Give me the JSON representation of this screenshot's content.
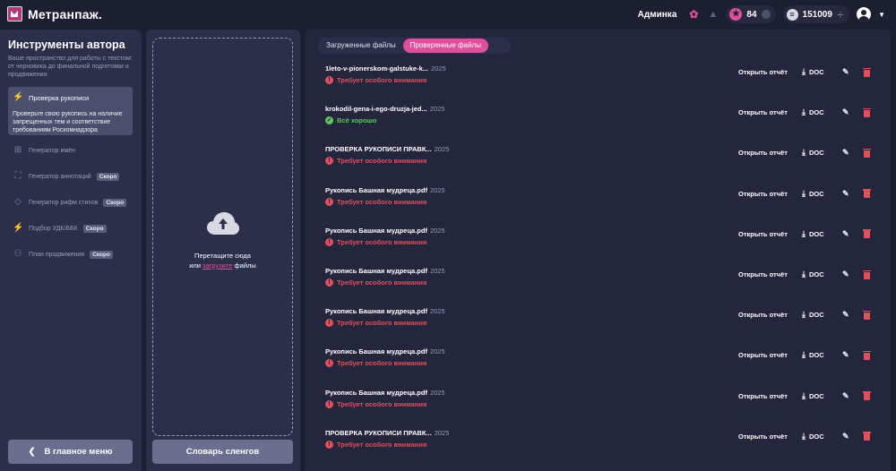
{
  "header": {
    "logo_text": "Метранпаж.",
    "user_name": "Админка",
    "stars": "84",
    "coins": "151009"
  },
  "sidebar": {
    "title": "Инструменты автора",
    "description": "Ваше пространство для работы с текстом: от черновика до финальной подготовки и продвижения.",
    "active": {
      "label": "Проверка рукописи",
      "description": "Проверьте свою рукопись на наличие запрещенных тем и соответствие требованиям Роскомнадзора"
    },
    "items": [
      {
        "label": "Генератор имён",
        "badge": ""
      },
      {
        "label": "Генератор аннотаций",
        "badge": "Скоро"
      },
      {
        "label": "Генератор рифм стихов",
        "badge": "Скоро"
      },
      {
        "label": "Подбор УДК/ББК",
        "badge": "Скоро"
      },
      {
        "label": "План продвижения",
        "badge": "Скоро"
      }
    ],
    "back_label": "В главное меню"
  },
  "upload": {
    "line1": "Перетащите сюда",
    "line2_pre": "или",
    "link": "загрузите",
    "line2_post": "файлы",
    "slang_button": "Словарь сленгов"
  },
  "tabs": {
    "uploaded": "Загруженные файлы",
    "checked": "Проверенные файлы"
  },
  "actions": {
    "open_report": "Открыть отчёт",
    "doc": "DOC"
  },
  "files": [
    {
      "name": "1leto-v-pionerskom-galstuke-k...",
      "year": "2025",
      "status": "Требует особого внимания",
      "ok": false
    },
    {
      "name": "krokodil-gena-i-ego-druzja-jed...",
      "year": "2025",
      "status": "Всё хорошо",
      "ok": true
    },
    {
      "name": "ПРОВЕРКА РУКОПИСИ ПРАВК...",
      "year": "2025",
      "status": "Требует особого внимания",
      "ok": false
    },
    {
      "name": "Рукопись Башная мудреца.pdf",
      "year": "2025",
      "status": "Требует особого внимания",
      "ok": false
    },
    {
      "name": "Рукопись Башная мудреца.pdf",
      "year": "2025",
      "status": "Требует особого внимания",
      "ok": false
    },
    {
      "name": "Рукопись Башная мудреца.pdf",
      "year": "2025",
      "status": "Требует особого внимания",
      "ok": false
    },
    {
      "name": "Рукопись Башная мудреца.pdf",
      "year": "2025",
      "status": "Требует особого внимания",
      "ok": false
    },
    {
      "name": "Рукопись Башная мудреца.pdf",
      "year": "2025",
      "status": "Требует особого внимания",
      "ok": false
    },
    {
      "name": "Рукопись Башная мудреца.pdf",
      "year": "2025",
      "status": "Требует особого внимания",
      "ok": false
    },
    {
      "name": "ПРОВЕРКА РУКОПИСИ ПРАВК...",
      "year": "2025",
      "status": "Требует особого внимания",
      "ok": false
    }
  ],
  "colors": {
    "accent": "#e0509a",
    "warning": "#e0505a",
    "success": "#5ac85a",
    "background": "#1c1e32",
    "panel": "#2c2f4a"
  }
}
